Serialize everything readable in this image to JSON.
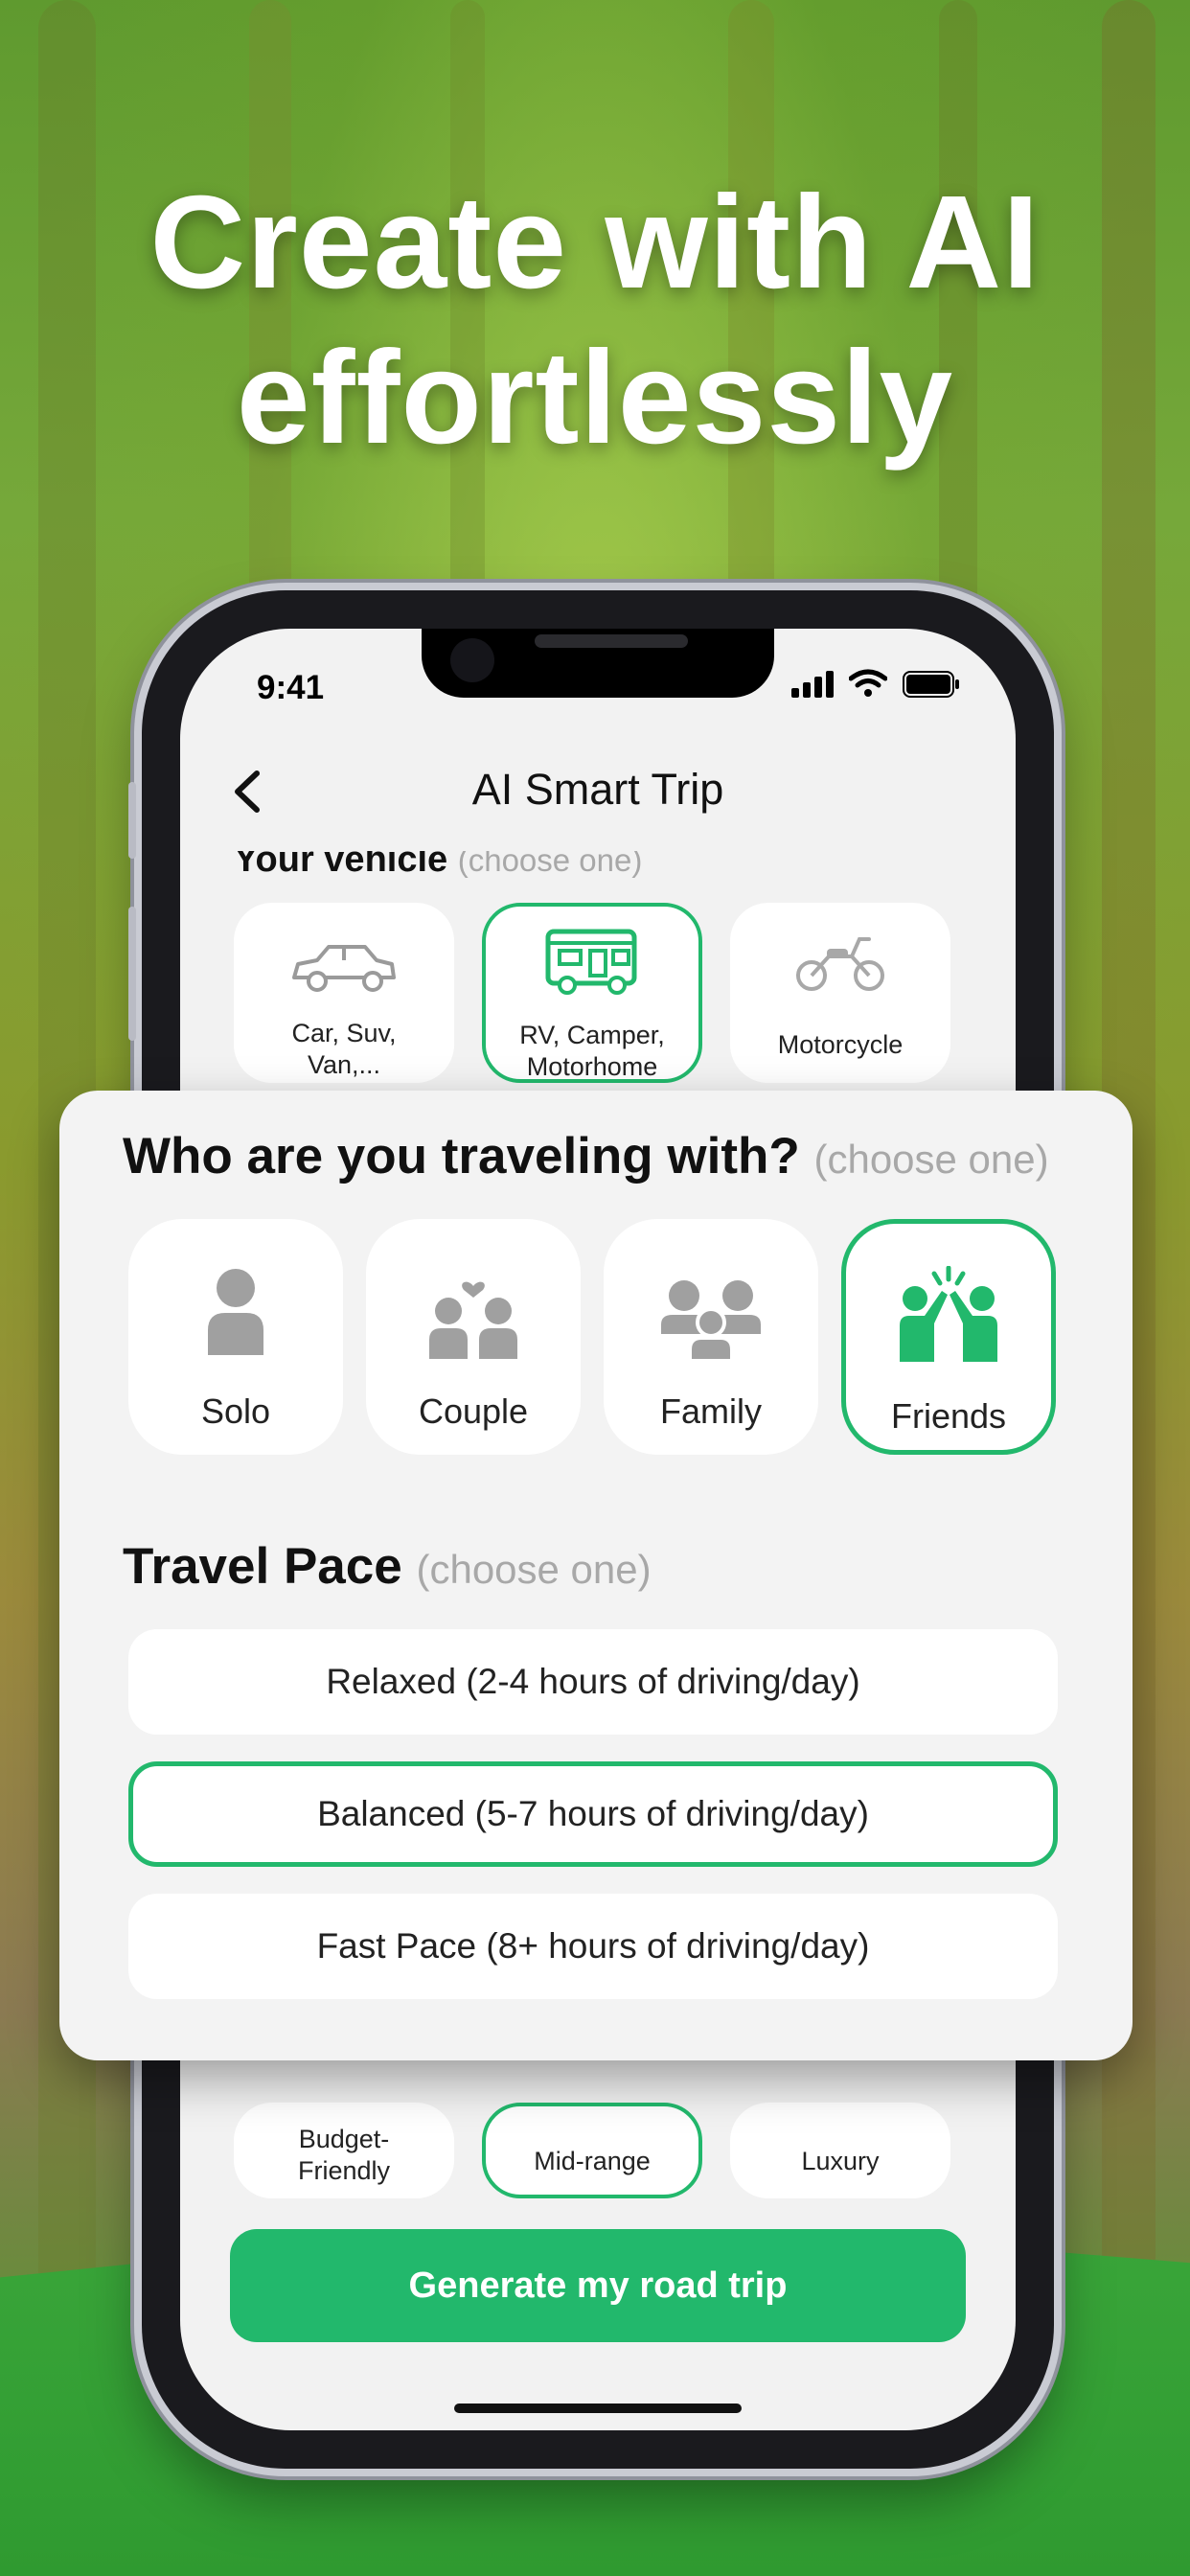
{
  "headline": {
    "line1": "Create with AI",
    "line2": "effortlessly"
  },
  "status_bar": {
    "time": "9:41"
  },
  "nav": {
    "title": "AI Smart Trip"
  },
  "vehicle": {
    "label": "Your vehicle",
    "hint": "(choose one)",
    "options": [
      {
        "label_line1": "Car, Suv,",
        "label_line2": "Van,...",
        "icon": "car-icon"
      },
      {
        "label_line1": "RV, Camper,",
        "label_line2": "Motorhome",
        "icon": "rv-icon",
        "selected": true
      },
      {
        "label_line1": "Motorcycle",
        "label_line2": "",
        "icon": "motorcycle-icon"
      }
    ]
  },
  "companions": {
    "title": "Who are you traveling with?",
    "hint": "(choose one)",
    "options": [
      {
        "label": "Solo",
        "icon": "solo-person-icon"
      },
      {
        "label": "Couple",
        "icon": "couple-icon"
      },
      {
        "label": "Family",
        "icon": "family-icon"
      },
      {
        "label": "Friends",
        "icon": "friends-high-five-icon",
        "selected": true
      }
    ]
  },
  "pace": {
    "title": "Travel Pace",
    "hint": "(choose one)",
    "options": [
      {
        "label": "Relaxed (2-4 hours of driving/day)"
      },
      {
        "label": "Balanced (5-7 hours of driving/day)",
        "selected": true
      },
      {
        "label": "Fast Pace (8+ hours of driving/day)"
      }
    ]
  },
  "budget": {
    "options": [
      {
        "label_line1": "Budget-",
        "label_line2": "Friendly"
      },
      {
        "label_line1": "Mid-range",
        "selected": true
      },
      {
        "label_line1": "Luxury"
      }
    ]
  },
  "generate_button": {
    "label": "Generate my road trip"
  },
  "colors": {
    "accent": "#22b86c",
    "muted_icon": "#a0a0a0",
    "screen_bg": "#f2f2f2"
  }
}
